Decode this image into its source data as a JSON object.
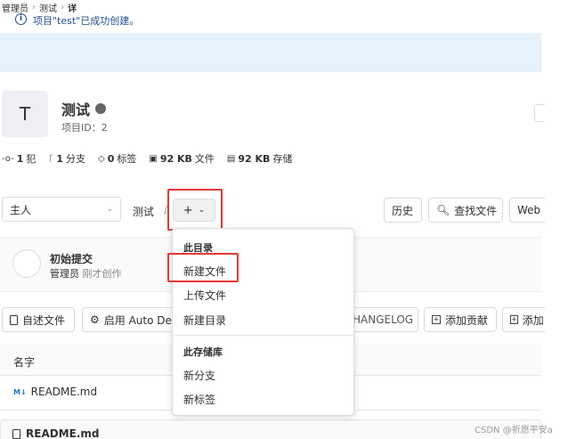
{
  "breadcrumb": {
    "items": [
      "管理员",
      "测试",
      "详"
    ],
    "sep": "›"
  },
  "alert": {
    "icon": "info-icon",
    "text": "项目\"test\"已成功创建。"
  },
  "project": {
    "avatar_letter": "T",
    "name": "测试",
    "visibility_icon": "globe-icon",
    "id_label": "项目ID：2"
  },
  "stats": [
    {
      "icon": "commit-icon",
      "value": "1",
      "label": "犯"
    },
    {
      "icon": "branch-icon",
      "value": "1",
      "label": "分支"
    },
    {
      "icon": "tag-icon",
      "value": "0",
      "label": "标签"
    },
    {
      "icon": "file-icon",
      "value": "92 KB",
      "label": "文件"
    },
    {
      "icon": "storage-icon",
      "value": "92 KB",
      "label": "存储"
    }
  ],
  "toolbar": {
    "branch": "主人",
    "path": "测试",
    "slash": "/",
    "plus": "+",
    "history": "历史",
    "find_file": "查找文件",
    "web_ide": "Web"
  },
  "commit": {
    "title": "初始提交",
    "author": "管理员",
    "time": "刚才创作"
  },
  "actions": {
    "readme": "自述文件",
    "auto_devops": "启用 Auto Dev",
    "changelog": "HANGELOG",
    "contributing": "添加贡献",
    "add_more": "添加"
  },
  "files": {
    "col_name": "名字",
    "rows": [
      {
        "icon": "markdown-icon",
        "icon_text": "M↓",
        "name": "README.md"
      }
    ]
  },
  "readme_header": {
    "name": "README.md"
  },
  "dropdown": {
    "section1_header": "此目录",
    "section1_items": [
      "新建文件",
      "上传文件",
      "新建目录"
    ],
    "section2_header": "此存储库",
    "section2_items": [
      "新分支",
      "新标签"
    ]
  },
  "watermark": "CSDN @祈愿平安a",
  "colors": {
    "alert_bg": "#e5f1fb",
    "alert_text": "#1f4f8c",
    "highlight": "#e53935"
  }
}
